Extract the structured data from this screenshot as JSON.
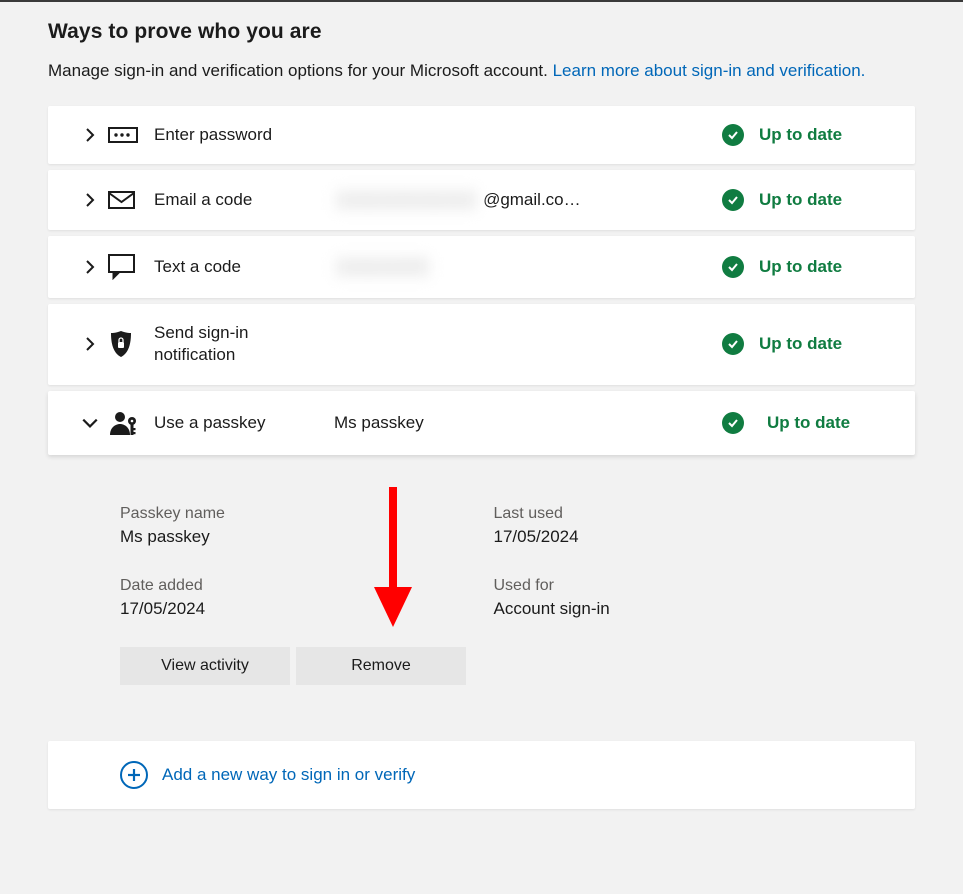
{
  "heading": "Ways to prove who you are",
  "subheading": "Manage sign-in and verification options for your Microsoft account. ",
  "learn_more": "Learn more about sign-in and verification.",
  "status_text": "Up to date",
  "methods": [
    {
      "label": "Enter password",
      "detail": ""
    },
    {
      "label": "Email a code",
      "detail": "@gmail.co…",
      "blurred": true
    },
    {
      "label": "Text a code",
      "detail": "",
      "blurred": true
    },
    {
      "label": "Send sign-in notification",
      "detail": ""
    },
    {
      "label": "Use a passkey",
      "detail": "Ms passkey"
    }
  ],
  "passkey_panel": {
    "name_label": "Passkey name",
    "name_value": "Ms passkey",
    "last_used_label": "Last used",
    "last_used_value": "17/05/2024",
    "date_added_label": "Date added",
    "date_added_value": "17/05/2024",
    "used_for_label": "Used for",
    "used_for_value": "Account sign-in",
    "view_activity": "View activity",
    "remove": "Remove"
  },
  "add_new": "Add a new way to sign in or verify"
}
